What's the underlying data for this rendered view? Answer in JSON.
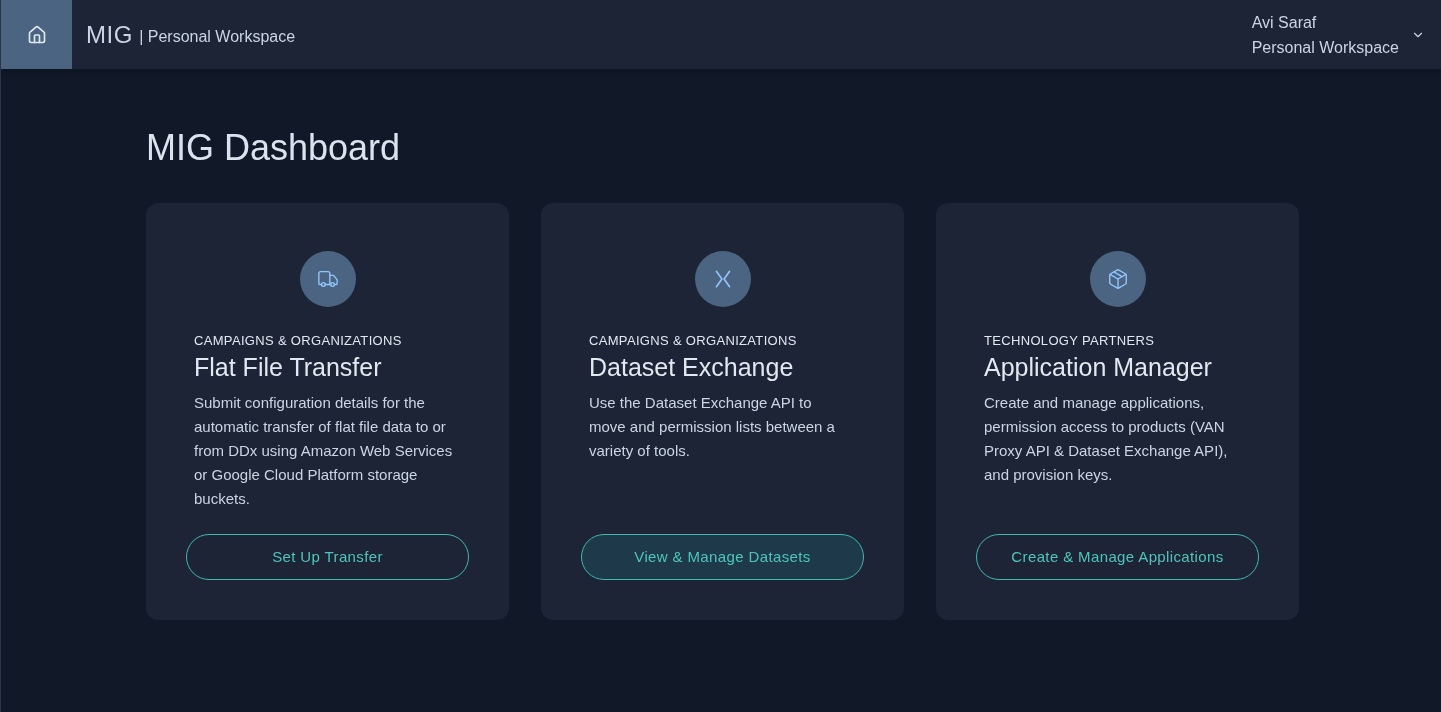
{
  "header": {
    "brand": "MIG",
    "workspace": "| Personal Workspace",
    "user": {
      "name": "Avi Saraf",
      "workspace": "Personal Workspace"
    }
  },
  "page_title": "MIG Dashboard",
  "cards": [
    {
      "kind": "truck",
      "category": "CAMPAIGNS & ORGANIZATIONS",
      "title": "Flat File Transfer",
      "description": "Submit configuration details for the automatic transfer of flat file data to or from DDx using Amazon Web Services or Google Cloud Platform storage buckets.",
      "button": {
        "label": "Set Up Transfer",
        "highlighted": false
      }
    },
    {
      "kind": "exchange",
      "category": "CAMPAIGNS & ORGANIZATIONS",
      "title": "Dataset Exchange",
      "description": "Use the Dataset Exchange API to move and permission lists between a variety of tools.",
      "button": {
        "label": "View & Manage Datasets",
        "highlighted": true
      }
    },
    {
      "kind": "box",
      "category": "TECHNOLOGY PARTNERS",
      "title": "Application Manager",
      "description": "Create and manage applications, permission access to products (VAN Proxy API & Dataset Exchange API), and provision keys.",
      "button": {
        "label": "Create & Manage Applications",
        "highlighted": false
      }
    }
  ]
}
